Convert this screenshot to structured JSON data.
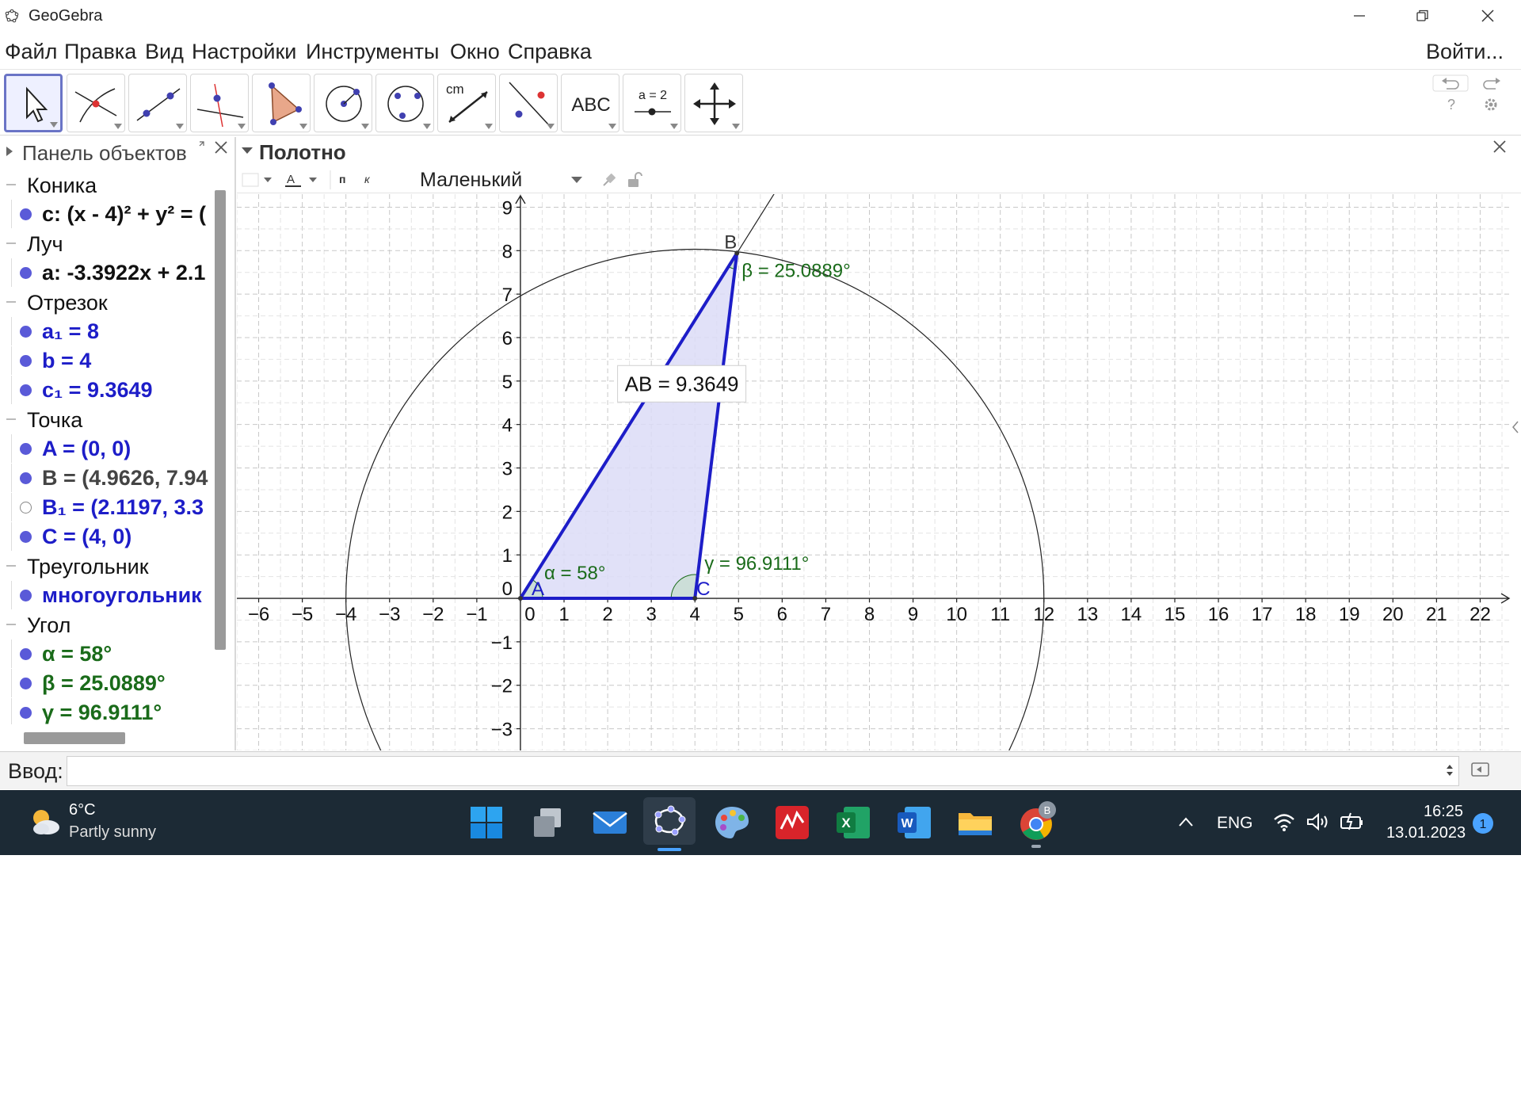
{
  "window": {
    "title": "GeoGebra"
  },
  "menu": {
    "items": [
      "Файл",
      "Правка",
      "Вид",
      "Настройки",
      "Инструменты",
      "Окно",
      "Справка"
    ],
    "login": "Войти..."
  },
  "toolbar": {
    "tools": [
      "move-tool",
      "intersect-tool",
      "line-tool",
      "perpendicular-tool",
      "polygon-tool",
      "circle-center-tool",
      "circle-three-points-tool",
      "distance-tool",
      "reflect-tool",
      "text-tool",
      "slider-tool",
      "move-view-tool"
    ],
    "text_tool_label": "ABC",
    "slider_tool_label": "a = 2",
    "distance_tool_label": "cm"
  },
  "algebra": {
    "title": "Панель объектов",
    "categories": [
      {
        "label": "Коника",
        "items": [
          {
            "text": "c: (x - 4)² + y² = (",
            "color": "#111111",
            "visible": true
          }
        ]
      },
      {
        "label": "Луч",
        "items": [
          {
            "text": "a: -3.3922x + 2.1",
            "color": "#111111",
            "visible": true
          }
        ]
      },
      {
        "label": "Отрезок",
        "items": [
          {
            "text": "a₁ = 8",
            "color": "#1d1dc8",
            "visible": true
          },
          {
            "text": "b = 4",
            "color": "#1d1dc8",
            "visible": true
          },
          {
            "text": "c₁ = 9.3649",
            "color": "#1d1dc8",
            "visible": true
          }
        ]
      },
      {
        "label": "Точка",
        "items": [
          {
            "text": "A = (0, 0)",
            "color": "#1d1dc8",
            "visible": true
          },
          {
            "text": "B = (4.9626, 7.94",
            "color": "#444444",
            "visible": true
          },
          {
            "text": "B₁ = (2.1197, 3.3",
            "color": "#1d1dc8",
            "visible": false
          },
          {
            "text": "C = (4, 0)",
            "color": "#1d1dc8",
            "visible": true
          }
        ]
      },
      {
        "label": "Треугольник",
        "items": [
          {
            "text": "многоугольник",
            "color": "#1d1dc8",
            "visible": true
          }
        ]
      },
      {
        "label": "Угол",
        "items": [
          {
            "text": "α = 58°",
            "color": "#1a6b1a",
            "visible": true
          },
          {
            "text": "β = 25.0889°",
            "color": "#1a6b1a",
            "visible": true
          },
          {
            "text": "γ = 96.9111°",
            "color": "#1a6b1a",
            "visible": true
          }
        ]
      }
    ]
  },
  "graphics": {
    "title": "Полотно",
    "size_select": "Маленький",
    "style_point": "п",
    "style_italic": "к",
    "style_color": "A",
    "x_range": [
      -6.5,
      22.7
    ],
    "y_range": [
      -3.5,
      9.3
    ],
    "x_ticks": [
      -6,
      -5,
      -4,
      -3,
      -2,
      -1,
      0,
      1,
      2,
      3,
      4,
      5,
      6,
      7,
      8,
      9,
      10,
      11,
      12,
      13,
      14,
      15,
      16,
      17,
      18,
      19,
      20,
      21,
      22
    ],
    "y_ticks": [
      -3,
      -2,
      -1,
      0,
      1,
      2,
      3,
      4,
      5,
      6,
      7,
      8,
      9
    ],
    "points": {
      "A": [
        0,
        0
      ],
      "B": [
        4.9626,
        7.9418
      ],
      "C": [
        4,
        0
      ]
    },
    "point_labels": [
      "A",
      "B",
      "C"
    ],
    "circle": {
      "center": [
        4,
        0
      ],
      "radius": 8
    },
    "ray_direction": [
      4.9626,
      7.9418
    ],
    "polygon_fill": "#dcdcf7",
    "segment_color": "#1d1dc8",
    "angle_color": "#1a6b1a",
    "labels": {
      "ab": "AB = 9.3649",
      "alpha": "α = 58°",
      "beta": "β = 25.0889°",
      "gamma": "γ = 96.9111°"
    }
  },
  "input": {
    "label": "Ввод:",
    "value": ""
  },
  "taskbar": {
    "weather_temp": "6°C",
    "weather_desc": "Partly sunny",
    "lang": "ENG",
    "time": "16:25",
    "date": "13.01.2023",
    "notifications": "1",
    "chrome_badge": "B",
    "apps": [
      "start-icon",
      "task-view-icon",
      "mail-icon",
      "geogebra-icon",
      "paint-icon",
      "pdf-icon",
      "excel-icon",
      "word-icon",
      "explorer-icon",
      "chrome-icon"
    ]
  }
}
